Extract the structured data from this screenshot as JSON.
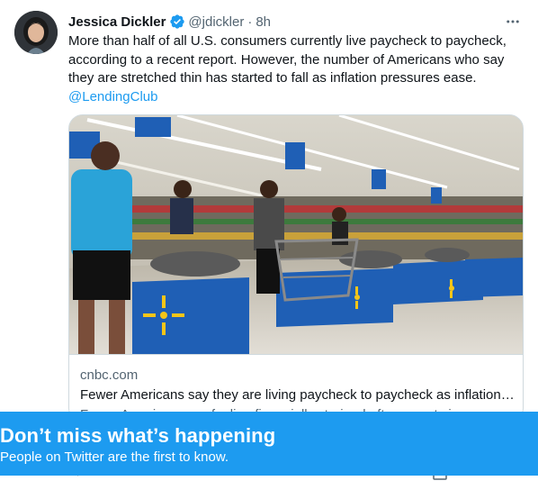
{
  "tweet": {
    "author_name": "Jessica Dickler",
    "handle": "@jdickler",
    "separator": "·",
    "time": "8h",
    "text": "More than half of all U.S. consumers currently live paycheck to paycheck, according to a recent report. However, the number of Americans who say they are stretched thin has started to fall as inflation pressures ease.",
    "mention": "@LendingClub"
  },
  "icons": {
    "verified": "verified-badge-icon",
    "more": "more-options-icon"
  },
  "card": {
    "domain": "cnbc.com",
    "title": "Fewer Americans say they are living paycheck to paycheck as inflation…",
    "description": "Fewer Americans are feeling financially strained after recent signs"
  },
  "banner": {
    "title": "Don’t miss what’s happening",
    "subtitle": "People on Twitter are the first to know."
  },
  "colors": {
    "accent": "#1d9bf0",
    "text": "#0f1419",
    "secondary": "#536471",
    "border": "#cfd9de"
  }
}
